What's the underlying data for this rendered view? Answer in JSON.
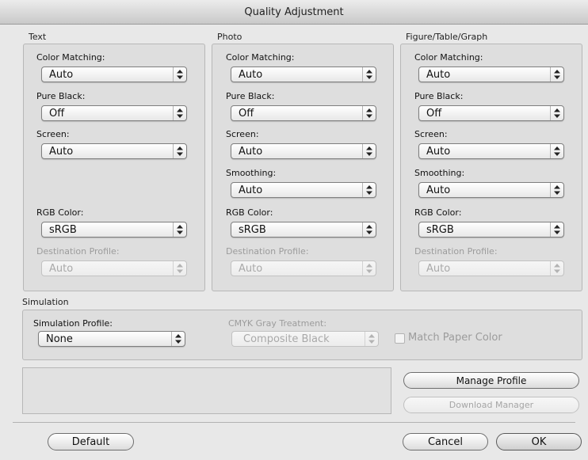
{
  "window": {
    "title": "Quality Adjustment"
  },
  "labels": {
    "color_matching": "Color Matching:",
    "pure_black": "Pure Black:",
    "screen": "Screen:",
    "smoothing": "Smoothing:",
    "rgb_color": "RGB Color:",
    "destination_profile": "Destination Profile:"
  },
  "text": {
    "title": "Text",
    "color_matching": "Auto",
    "pure_black": "Off",
    "screen": "Auto",
    "rgb_color": "sRGB",
    "destination_profile": "Auto"
  },
  "photo": {
    "title": "Photo",
    "color_matching": "Auto",
    "pure_black": "Off",
    "screen": "Auto",
    "smoothing": "Auto",
    "rgb_color": "sRGB",
    "destination_profile": "Auto"
  },
  "figure": {
    "title": "Figure/Table/Graph",
    "color_matching": "Auto",
    "pure_black": "Off",
    "screen": "Auto",
    "smoothing": "Auto",
    "rgb_color": "sRGB",
    "destination_profile": "Auto"
  },
  "simulation": {
    "title": "Simulation",
    "profile_label": "Simulation Profile:",
    "profile_value": "None",
    "cmyk_label": "CMYK Gray Treatment:",
    "cmyk_value": "Composite Black",
    "match_paper_label": "Match Paper Color",
    "match_paper_checked": false
  },
  "buttons": {
    "manage_profile": "Manage Profile",
    "download_manager": "Download Manager",
    "default": "Default",
    "cancel": "Cancel",
    "ok": "OK"
  },
  "icons": {
    "popup_arrows": "up-down-arrows-icon"
  }
}
